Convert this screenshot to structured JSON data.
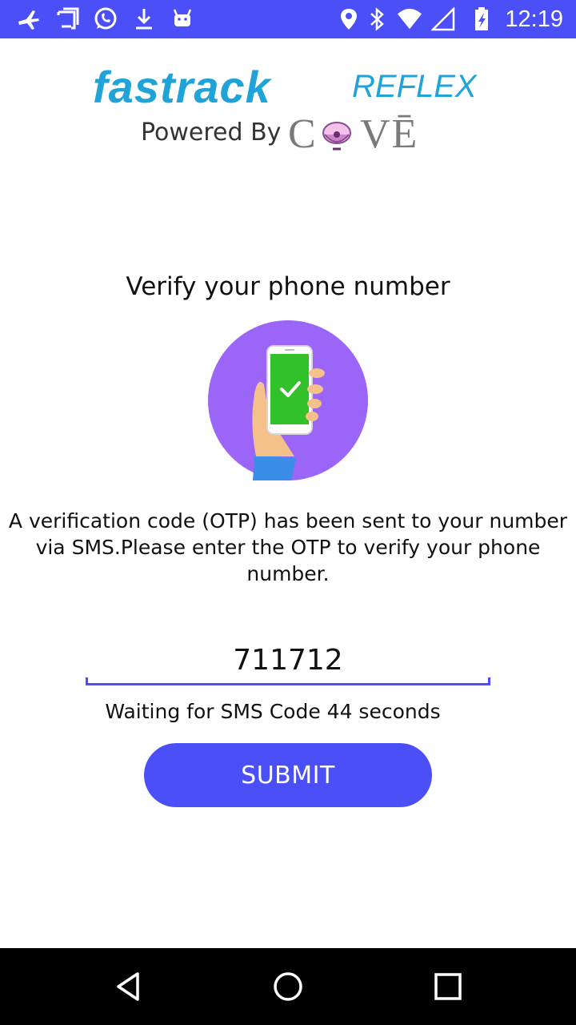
{
  "status_bar": {
    "time": "12:19",
    "left_icons": [
      "airplane-icon",
      "screenshot-icon",
      "whatsapp-icon",
      "download-icon",
      "android-icon"
    ],
    "right_icons": [
      "location-icon",
      "bluetooth-icon",
      "wifi-icon",
      "battery-icon"
    ],
    "background": "#4a4ff7"
  },
  "logo": {
    "brand": "fastrack",
    "brand_sub": "REFLEX",
    "powered_by": "Powered By",
    "cove_left": "C",
    "cove_right": "VĒ",
    "brand_color": "#1fa3d8"
  },
  "main": {
    "heading": "Verify your phone number",
    "info": "A verification code (OTP) has been sent to your number via SMS.Please enter the OTP to verify your phone number.",
    "otp_value": "711712",
    "waiting_text": "Waiting for SMS Code 44 seconds",
    "submit_label": "SUBMIT",
    "accent": "#4a4ff7",
    "illustration_bg": "#9b66f7"
  },
  "nav_bar": {
    "buttons": [
      "back-icon",
      "home-icon",
      "recents-icon"
    ]
  }
}
